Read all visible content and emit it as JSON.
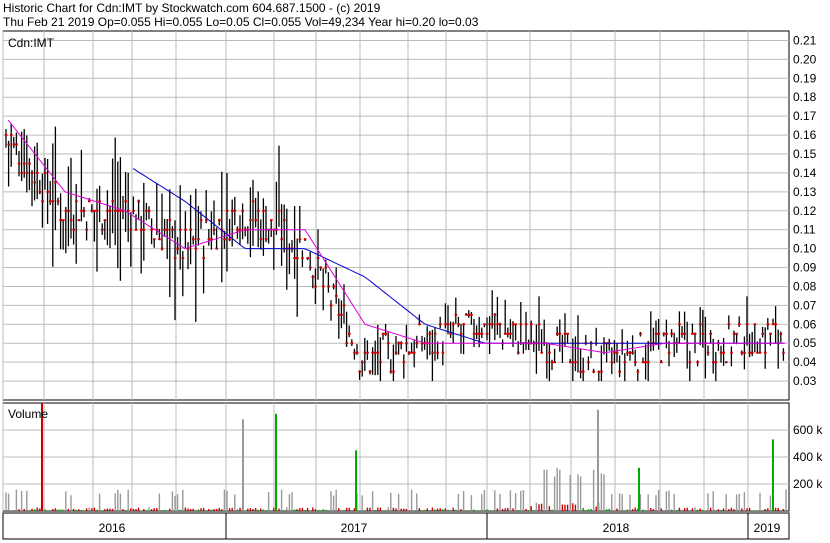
{
  "header": {
    "line1": "Historic Chart for Cdn:IMT by Stockwatch.com 604.687.1500 - (c) 2019",
    "line2": "Thu Feb 21 2019  Op=0.055  Hi=0.055  Lo=0.05  Cl=0.055  Vol=49,234  Year hi=0.20  lo=0.03"
  },
  "price_panel": {
    "label": "Cdn:IMT"
  },
  "volume_panel": {
    "label": "Volume"
  },
  "chart_data": [
    {
      "type": "line",
      "panel": "price",
      "ylim": [
        0.02,
        0.215
      ],
      "yticks": [
        "0.21",
        "0.20",
        "0.19",
        "0.18",
        "0.17",
        "0.16",
        "0.15",
        "0.14",
        "0.13",
        "0.12",
        "0.11",
        "0.10",
        "0.09",
        "0.08",
        "0.07",
        "0.06",
        "0.05",
        "0.04",
        "0.03"
      ],
      "x": [
        "2016-01",
        "2016-04",
        "2016-07",
        "2016-10",
        "2017-01",
        "2017-04",
        "2017-07",
        "2017-10",
        "2018-01",
        "2018-04",
        "2018-07",
        "2018-10",
        "2019-01",
        "2019-02"
      ],
      "series": [
        {
          "values": [
            0.16,
            0.12,
            0.12,
            0.1,
            0.12,
            0.1,
            0.04,
            0.05,
            0.06,
            0.05,
            0.04,
            0.05,
            0.05,
            0.055
          ]
        },
        {
          "values": [
            0.17,
            0.13,
            0.12,
            0.1,
            0.11,
            0.11,
            0.06,
            0.05,
            0.05,
            0.05,
            0.045,
            0.05,
            0.05,
            0.05
          ]
        },
        {
          "values": [
            null,
            null,
            0.145,
            0.125,
            0.1,
            0.1,
            0.085,
            0.06,
            0.05,
            0.05,
            0.05,
            0.05,
            0.05,
            0.05
          ]
        }
      ],
      "grid": true,
      "colors": {
        "bars": "#000000",
        "closes": "#cc0000",
        "short_ma": "#e000e0",
        "long_ma": "#0000cc"
      }
    },
    {
      "type": "bar",
      "panel": "volume",
      "ylim": [
        0,
        800000
      ],
      "yticks": [
        "600 k",
        "400 k",
        "200 k"
      ],
      "x": [
        "2016",
        "2017",
        "2018",
        "2019"
      ],
      "peaks": [
        800000,
        680000,
        720000,
        450000,
        750000,
        320000,
        530000
      ],
      "colors": {
        "up": "#00aa00",
        "down": "#cc0000",
        "flat": "#999999"
      }
    }
  ]
}
